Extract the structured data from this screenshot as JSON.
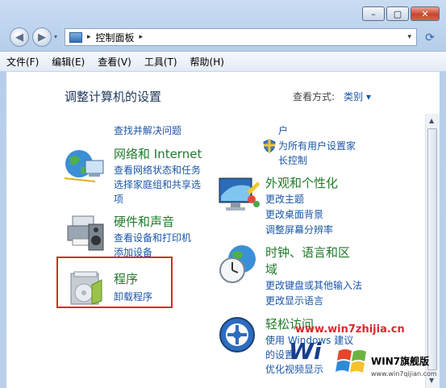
{
  "nav": {
    "back_glyph": "◀",
    "forward_glyph": "▶",
    "breadcrumb_root": "控制面板",
    "arrow": "▸",
    "dropdown": "▾",
    "refresh_glyph": "⟳"
  },
  "caption": {
    "minimize": "–",
    "maximize": "▢",
    "close": "✕"
  },
  "menu": [
    "文件(F)",
    "编辑(E)",
    "查看(V)",
    "工具(T)",
    "帮助(H)"
  ],
  "heading": "调整计算机的设置",
  "view_by_label": "查看方式:",
  "view_by_value": "类别 ▾",
  "left": {
    "top_link": "查找并解决问题",
    "network": {
      "title": "网络和 Internet",
      "links": [
        "查看网络状态和任务",
        "选择家庭组和共享选",
        "项"
      ]
    },
    "hardware": {
      "title": "硬件和声音",
      "links": [
        "查看设备和打印机",
        "添加设备"
      ]
    },
    "programs": {
      "title": "程序",
      "links": [
        "卸载程序"
      ]
    }
  },
  "right": {
    "top_partial": [
      "户"
    ],
    "parental": [
      "为所有用户设置家",
      "长控制"
    ],
    "appearance": {
      "title": "外观和个性化",
      "links": [
        "更改主题",
        "更改桌面背景",
        "调整屏幕分辨率"
      ]
    },
    "clock": {
      "title_lines": [
        "时钟、语言和区",
        "域"
      ],
      "links": [
        "更改键盘或其他输入法",
        "更改显示语言"
      ]
    },
    "ease": {
      "title": "轻松访问",
      "links": [
        "使用 Windows 建议",
        "的设置",
        "优化视频显示"
      ]
    }
  },
  "watermark": {
    "url": "www.win7zhijia.cn",
    "big": "Wi",
    "badge": "WIN7旗舰版",
    "small_url": "www.win7qijian.com"
  },
  "colors": {
    "link": "#1a56a8",
    "category": "#1f7a2a",
    "highlight": "#e0262b"
  }
}
